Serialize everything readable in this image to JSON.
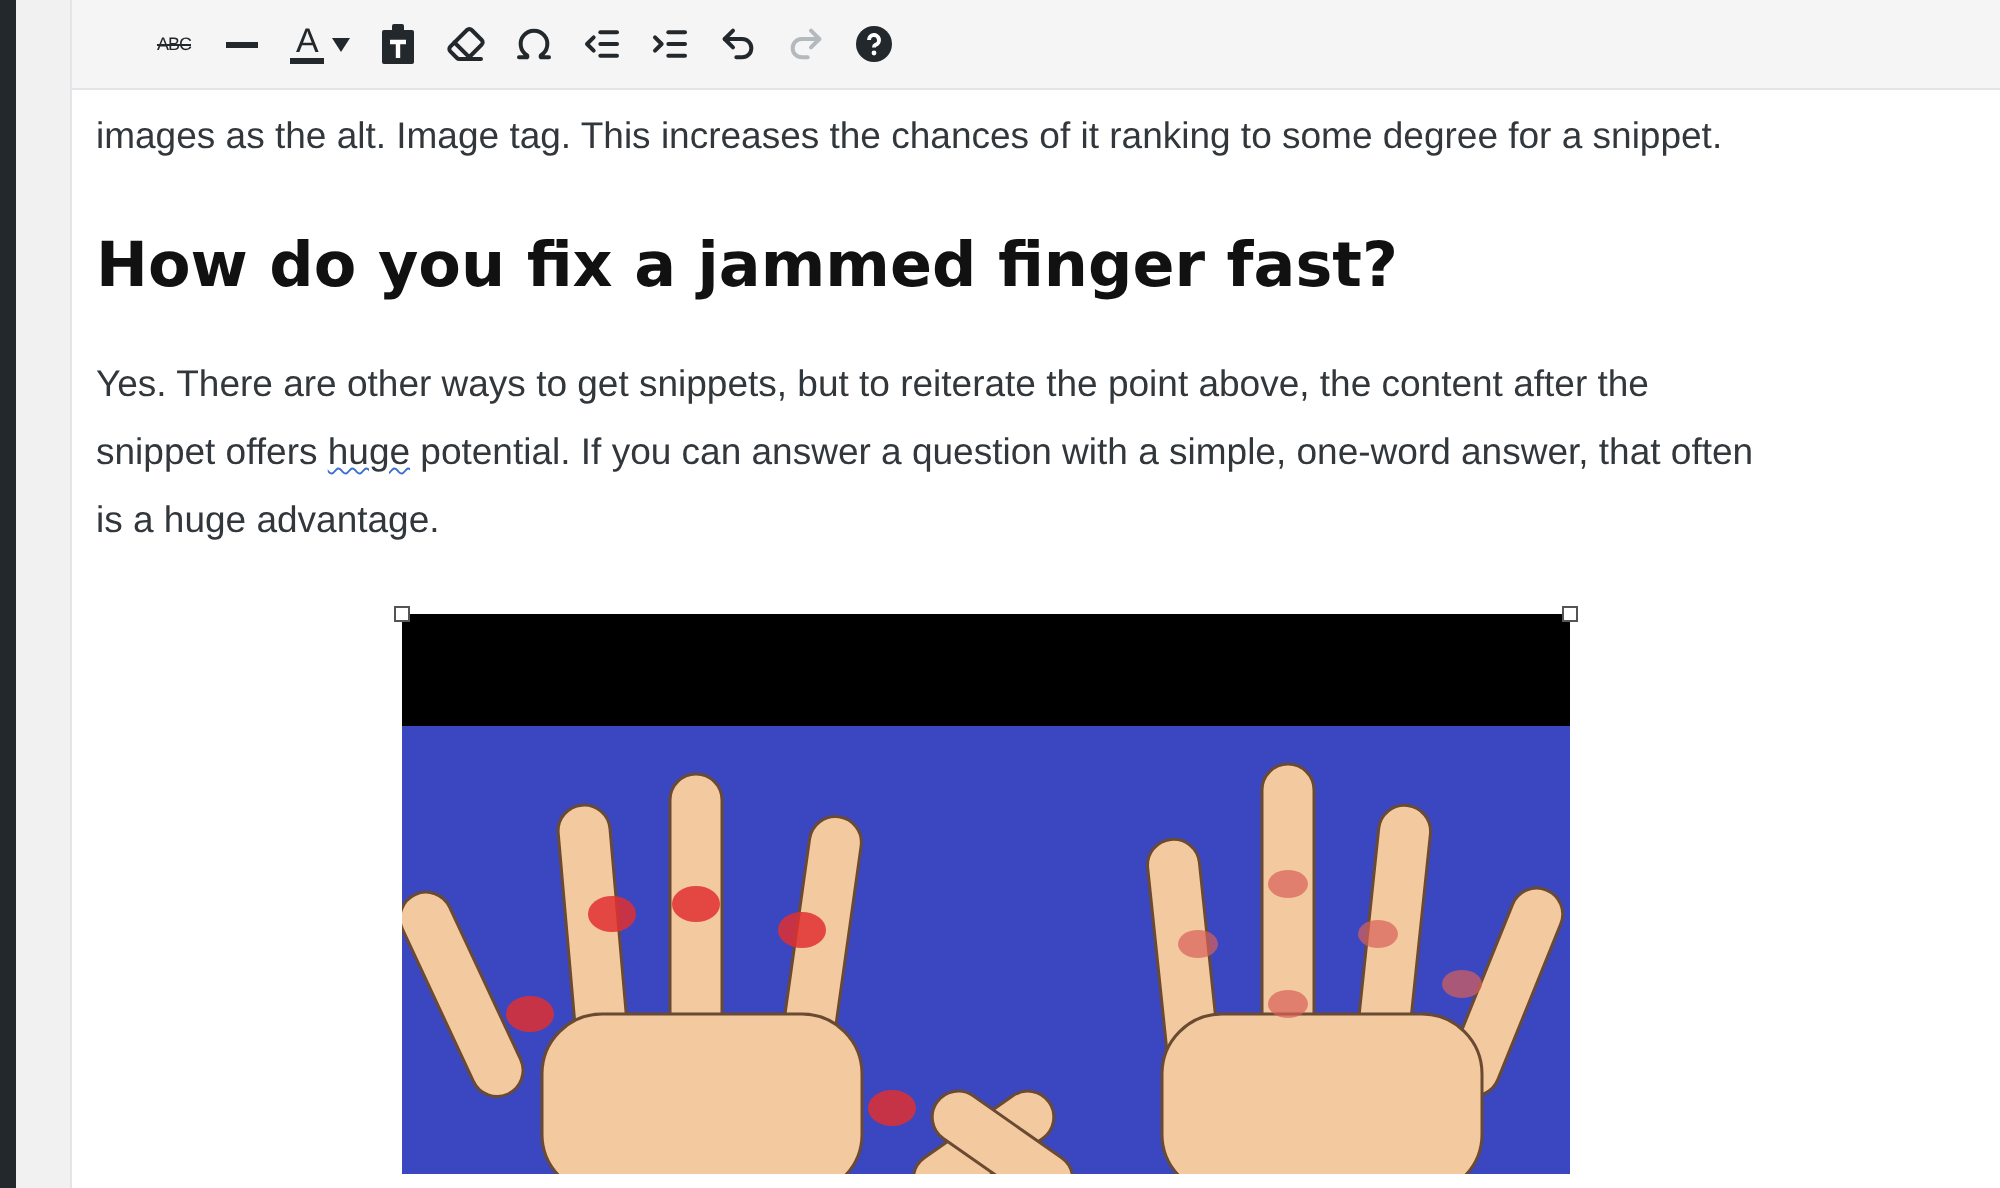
{
  "toolbar": {
    "buttons": [
      {
        "kind": "strikethrough",
        "label": "ABC",
        "disabled": false
      },
      {
        "kind": "horizontal-line",
        "disabled": false
      },
      {
        "kind": "text-color",
        "label": "A",
        "disabled": false
      },
      {
        "kind": "paste-text",
        "disabled": false
      },
      {
        "kind": "clear-formatting",
        "disabled": false
      },
      {
        "kind": "special-character",
        "disabled": false
      },
      {
        "kind": "outdent",
        "disabled": false
      },
      {
        "kind": "indent",
        "disabled": false
      },
      {
        "kind": "undo",
        "disabled": false
      },
      {
        "kind": "redo",
        "disabled": true
      },
      {
        "kind": "help",
        "disabled": false
      }
    ]
  },
  "content": [
    {
      "kind": "paragraph",
      "segments": [
        {
          "text": "images as the alt. Image tag. This increases the chances of it ranking to some degree for a snippet.",
          "misspelled": false
        }
      ]
    },
    {
      "kind": "heading",
      "text": "How do you fix a jammed finger fast?"
    },
    {
      "kind": "paragraph",
      "segments": [
        {
          "text": "Yes. There are other ways to get snippets, but to reiterate the point above, the content after the snippet offers ",
          "misspelled": false
        },
        {
          "text": "huge",
          "misspelled": true
        },
        {
          "text": " potential. If you can answer a question with a simple, one-word answer, that often is a huge advantage.",
          "misspelled": false
        }
      ]
    },
    {
      "kind": "image",
      "selected": true
    }
  ]
}
